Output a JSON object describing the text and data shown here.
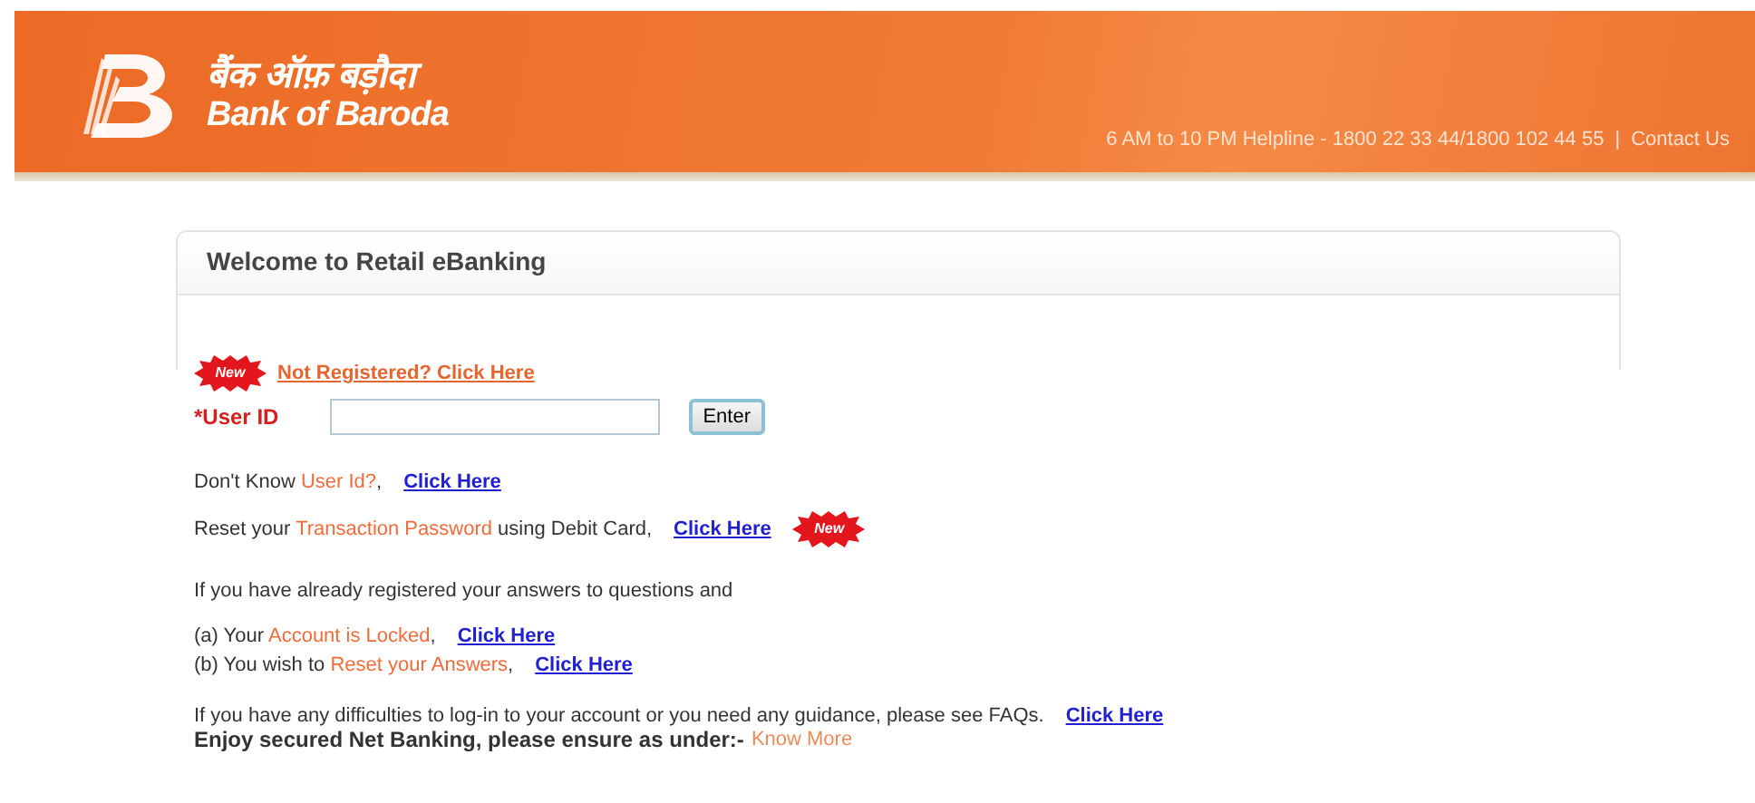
{
  "header": {
    "bank_name_hindi": "बैंक ऑफ़ बड़ौदा",
    "bank_name": "Bank of Baroda",
    "helpline": "6 AM to 10 PM Helpline - 1800 22 33 44/1800 102 44 55",
    "separator": "|",
    "contact_link": "Contact Us"
  },
  "panel": {
    "title": "Welcome to Retail eBanking",
    "register": {
      "badge": "New",
      "link": "Not Registered? Click Here"
    },
    "user_id": {
      "required_mark": "*",
      "label": "User ID",
      "button": "Enter"
    },
    "lines": [
      {
        "parts": [
          {
            "text": "Don't Know ",
            "highlight": false
          },
          {
            "text": "User Id?",
            "highlight": true
          },
          {
            "text": ",",
            "highlight": false
          }
        ],
        "link": "Click Here"
      },
      {
        "parts": [
          {
            "text": "Reset your ",
            "highlight": false
          },
          {
            "text": "Transaction Password",
            "highlight": true
          },
          {
            "text": " using Debit Card,",
            "highlight": false
          }
        ],
        "link": "Click Here",
        "badge": "New"
      },
      {
        "parts": [
          {
            "text": "If you have already registered your answers to questions and",
            "highlight": false
          }
        ]
      },
      {
        "parts": [
          {
            "text": "(a) Your ",
            "highlight": false
          },
          {
            "text": "Account is Locked",
            "highlight": true
          },
          {
            "text": ",",
            "highlight": false
          }
        ],
        "link": "Click Here"
      },
      {
        "parts": [
          {
            "text": "(b) You wish to ",
            "highlight": false
          },
          {
            "text": "Reset your Answers",
            "highlight": true
          },
          {
            "text": ",",
            "highlight": false
          }
        ],
        "link": "Click Here"
      },
      {
        "parts": [
          {
            "text": "If you have any difficulties to log-in to your account or you need any guidance, please see FAQs.",
            "highlight": false
          }
        ],
        "link": "Click Here"
      }
    ],
    "notice": {
      "text": "Enjoy secured Net Banking, please ensure as under:-",
      "link": "Know More"
    }
  }
}
